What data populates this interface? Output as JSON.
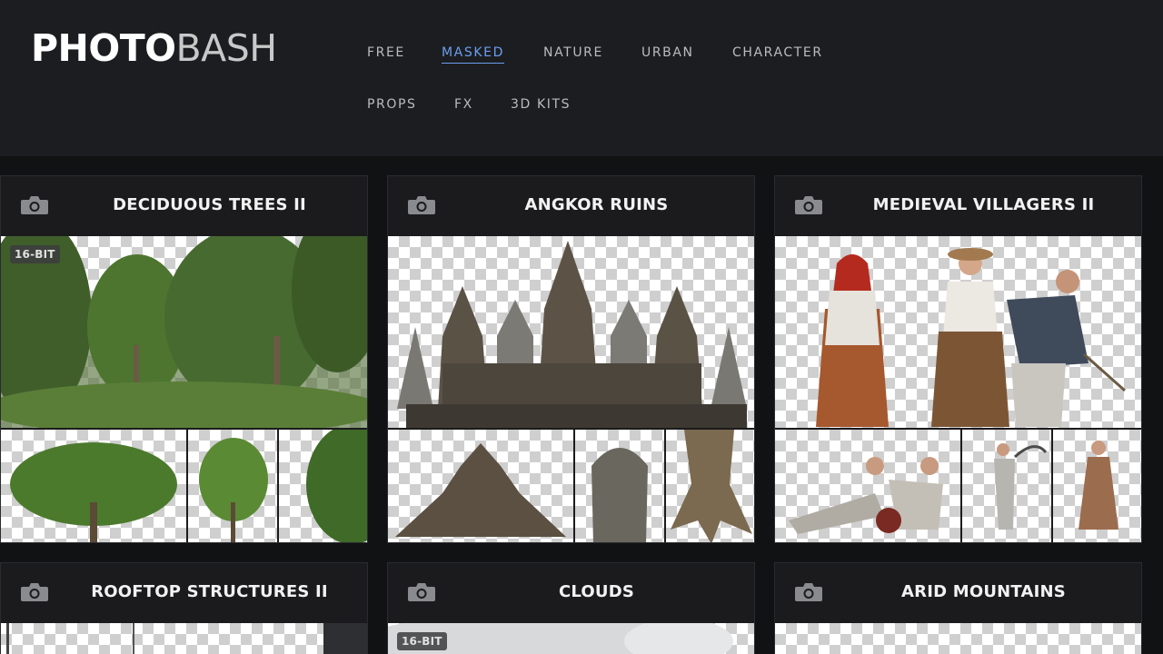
{
  "header": {
    "logo_part1": "PHOTO",
    "logo_part2": "BASH",
    "nav": [
      {
        "label": "FREE",
        "active": false
      },
      {
        "label": "MASKED",
        "active": true
      },
      {
        "label": "NATURE",
        "active": false
      },
      {
        "label": "URBAN",
        "active": false
      },
      {
        "label": "CHARACTER",
        "active": false
      },
      {
        "label": "PROPS",
        "active": false
      },
      {
        "label": "FX",
        "active": false
      },
      {
        "label": "3D KITS",
        "active": false
      }
    ]
  },
  "colors": {
    "accent": "#6b9ef0",
    "header_bg": "#1c1d20",
    "page_bg": "#111214",
    "card_bg": "#1b1b1d"
  },
  "cards": [
    {
      "title": "DECIDUOUS TREES II",
      "badge": "16-BIT",
      "icon": "camera-icon"
    },
    {
      "title": "ANGKOR RUINS",
      "badge": "",
      "icon": "camera-icon"
    },
    {
      "title": "MEDIEVAL VILLAGERS II",
      "badge": "",
      "icon": "camera-icon"
    },
    {
      "title": "ROOFTOP STRUCTURES II",
      "badge": "",
      "icon": "camera-icon"
    },
    {
      "title": "CLOUDS",
      "badge": "16-BIT",
      "icon": "camera-icon"
    },
    {
      "title": "ARID MOUNTAINS",
      "badge": "",
      "icon": "camera-icon"
    }
  ]
}
